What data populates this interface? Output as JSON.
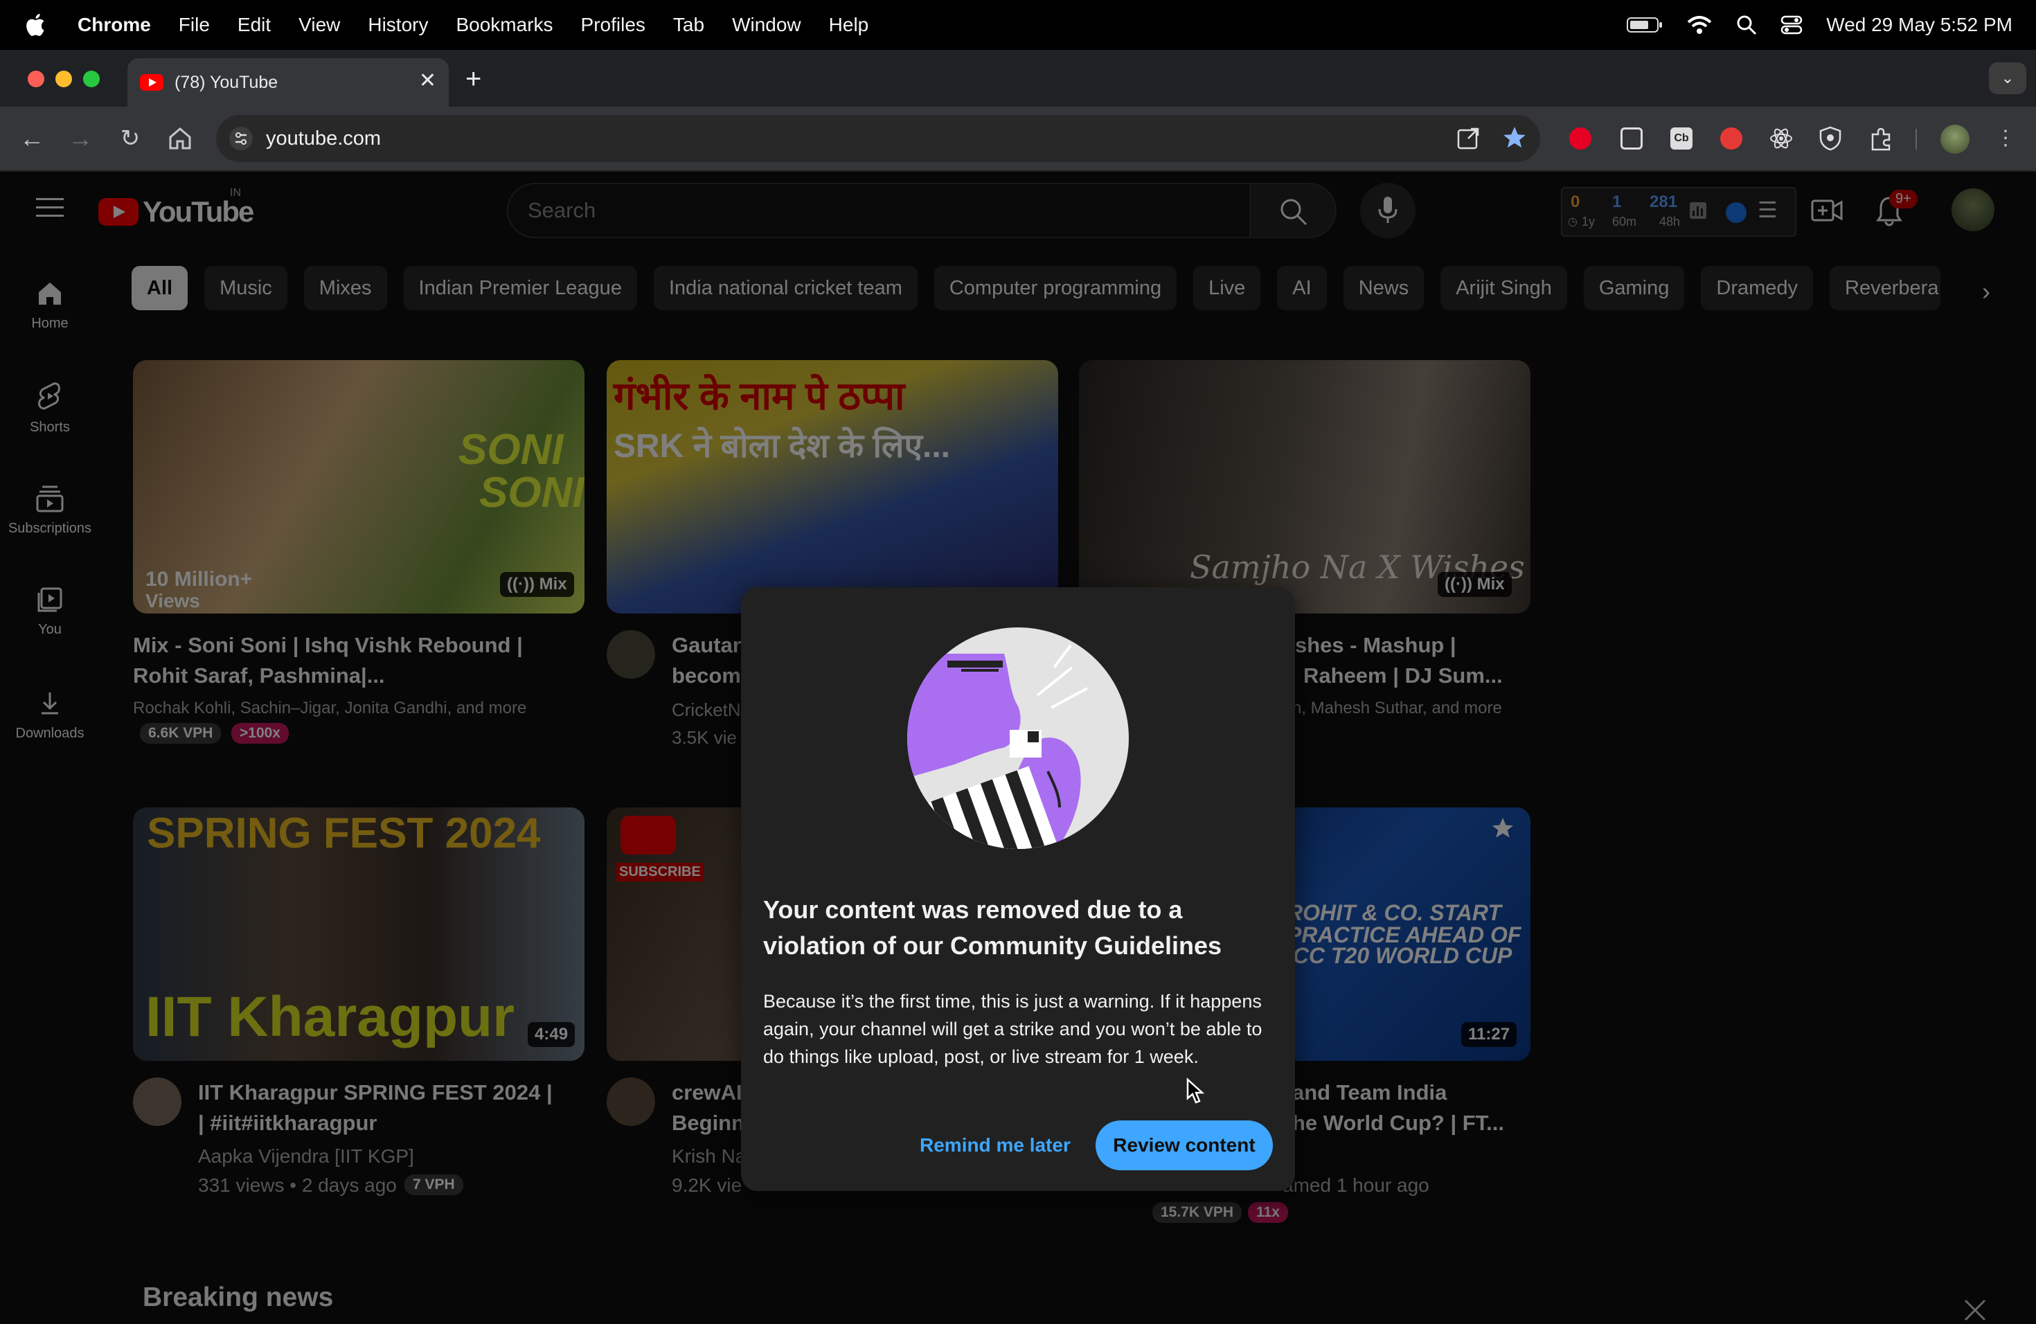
{
  "menubar": {
    "app": "Chrome",
    "items": [
      "File",
      "Edit",
      "View",
      "History",
      "Bookmarks",
      "Profiles",
      "Tab",
      "Window",
      "Help"
    ],
    "datetime": "Wed 29 May  5:52 PM"
  },
  "browser": {
    "tab_title": "(78) YouTube",
    "url": "youtube.com"
  },
  "youtube": {
    "logo_text": "YouTube",
    "region": "IN",
    "search_placeholder": "Search",
    "stats": {
      "v1": "0",
      "l1": "1y",
      "v2": "1",
      "l2": "60m",
      "v3": "281",
      "l3": "48h"
    },
    "notifications_badge": "9+",
    "nav": [
      {
        "label": "Home"
      },
      {
        "label": "Shorts"
      },
      {
        "label": "Subscriptions"
      },
      {
        "label": "You"
      },
      {
        "label": "Downloads"
      }
    ],
    "chips": [
      "All",
      "Music",
      "Mixes",
      "Indian Premier League",
      "India national cricket team",
      "Computer programming",
      "Live",
      "AI",
      "News",
      "Arijit Singh",
      "Gaming",
      "Dramedy",
      "Reverbera"
    ],
    "videos": [
      {
        "title_line1": "Mix - Soni Soni | Ishq Vishk Rebound |",
        "title_line2": "Rohit Saraf, Pashmina|...",
        "meta1": "Rochak Kohli, Sachin–Jigar, Jonita Gandhi, and more",
        "vph": "6.6K VPH",
        "ratio": ">100x",
        "badge": "Mix",
        "thumb_text_1": "SONI",
        "thumb_text_2": "SONI",
        "thumb_text_3": "10 Million+",
        "thumb_text_4": "Views"
      },
      {
        "title_line1": "Gautan",
        "title_line2": "becom",
        "meta1": "CricketN",
        "meta2": "3.5K vie",
        "thumb_text_1": "गंभीर के नाम पे ठप्पा",
        "thumb_text_2": "SRK ने बोला देश के लिए..."
      },
      {
        "title_line1": "shes - Mashup |",
        "title_line2": "Raheem | DJ Sum...",
        "meta1": "h, Mahesh Suthar, and more",
        "badge": "Mix",
        "thumb_text_1": "Samjho Na X Wishes"
      },
      {
        "title_line1": "IIT Kharagpur SPRING FEST 2024 |",
        "title_line2": "| #iit#iitkharagpur",
        "channel": "Aapka Vijendra [IIT KGP]",
        "meta": "331 views • 2 days ago",
        "vph": "7 VPH",
        "duration": "4:49",
        "thumb_text_1": "SPRING FEST 2024",
        "thumb_text_2": "IIT Kharagpur"
      },
      {
        "title_line1": "crewAI",
        "title_line2": "Beginn",
        "channel": "Krish Na",
        "meta": "9.2K vie",
        "thumb_text_1": "SUBSCRIBE"
      },
      {
        "title_line1": "and Team India",
        "title_line2": "he World Cup? | FT...",
        "meta": "amed 1 hour ago",
        "vph": "15.7K VPH",
        "ratio": "11x",
        "duration": "11:27",
        "thumb_text_1": "ROHIT & CO. START",
        "thumb_text_2": "PRACTICE AHEAD OF",
        "thumb_text_3": "ICC T20 WORLD CUP"
      }
    ],
    "section_title": "Breaking news"
  },
  "dialog": {
    "title": "Your content was removed due to a violation of our Community Guidelines",
    "body": "Because it’s the first time, this is just a warning. If it happens again, your channel will get a strike and you won’t be able to do things like upload, post, or live stream for 1 week.",
    "secondary_button": "Remind me later",
    "primary_button": "Review content"
  }
}
